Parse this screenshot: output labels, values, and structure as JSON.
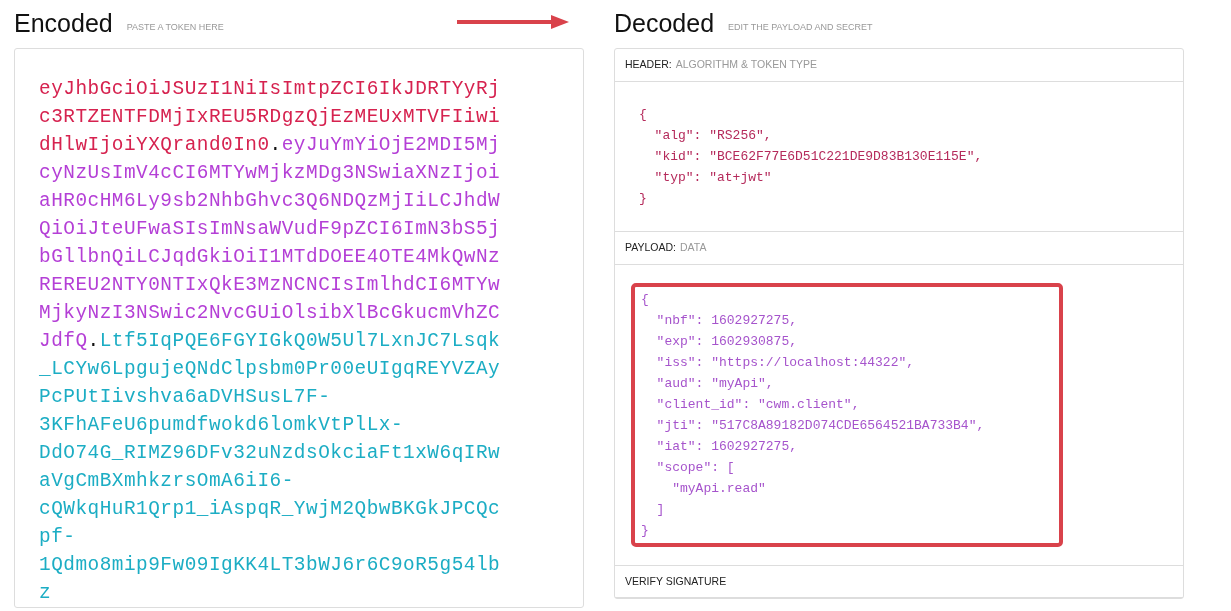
{
  "encoded": {
    "title": "Encoded",
    "subtitle": "PASTE A TOKEN HERE",
    "token": [
      {
        "kind": "header",
        "text": "eyJhbGciOiJSUzI1NiIsImtpZCI6IkJDRTYyRjc3RTZENTFDMjIxREU5RDgzQjEzMEUxMTVFIiwidHlwIjoiYXQrand0In0"
      },
      {
        "kind": "dot",
        "text": "."
      },
      {
        "kind": "payload",
        "text": "eyJuYmYiOjE2MDI5MjcyNzUsImV4cCI6MTYwMjkzMDg3NSwiaXNzIjoiaHR0cHM6Ly9sb2NhbGhvc3Q6NDQzMjIiLCJhdWQiOiJteUFwaSIsImNsaWVudF9pZCI6ImN3bS5jbGllbnQiLCJqdGkiOiI1MTdDOEE4OTE4MkQwNzREREU2NTY0NTIxQkE3MzNCNCIsImlhdCI6MTYwMjkyNzI3NSwic2NvcGUiOlsibXlBcGkucmVhZCJdfQ"
      },
      {
        "kind": "dot",
        "text": "."
      },
      {
        "kind": "signature",
        "text": "Ltf5IqPQE6FGYIGkQ0W5Ul7LxnJC7Lsqk_LCYw6LpgujeQNdClpsbm0Pr00eUIgqREYVZAyPcPUtIivshva6aDVHSusL7F-3KFhAFeU6pumdfwokd6lomkVtPlLx-DdO74G_RIMZ96DFv32uNzdsOkciaFt1xW6qIRwaVgCmBXmhkzrsOmA6iI6-cQWkqHuR1Qrp1_iAspqR_YwjM2QbwBKGkJPCQcpf-1Qdmo8mip9Fw09IgKK4LT3bWJ6r6C9oR5g54lbz"
      }
    ]
  },
  "arrow": true,
  "decoded": {
    "title": "Decoded",
    "subtitle": "EDIT THE PAYLOAD AND SECRET",
    "sections": [
      {
        "kind": "header",
        "label": "HEADER:",
        "sublabel": "ALGORITHM & TOKEN TYPE",
        "highlighted": false,
        "lines": [
          "{",
          "  \"alg\": \"RS256\",",
          "  \"kid\": \"BCE62F77E6D51C221DE9D83B130E115E\",",
          "  \"typ\": \"at+jwt\"",
          "}"
        ]
      },
      {
        "kind": "payload",
        "label": "PAYLOAD:",
        "sublabel": "DATA",
        "highlighted": true,
        "lines": [
          "{",
          "  \"nbf\": 1602927275,",
          "  \"exp\": 1602930875,",
          "  \"iss\": \"https://localhost:44322\",",
          "  \"aud\": \"myApi\",",
          "  \"client_id\": \"cwm.client\",",
          "  \"jti\": \"517C8A89182D074CDE6564521BA733B4\",",
          "  \"iat\": 1602927275,",
          "  \"scope\": [",
          "    \"myApi.read\"",
          "  ]",
          "}"
        ]
      },
      {
        "kind": "signature",
        "label": "VERIFY SIGNATURE"
      }
    ]
  }
}
